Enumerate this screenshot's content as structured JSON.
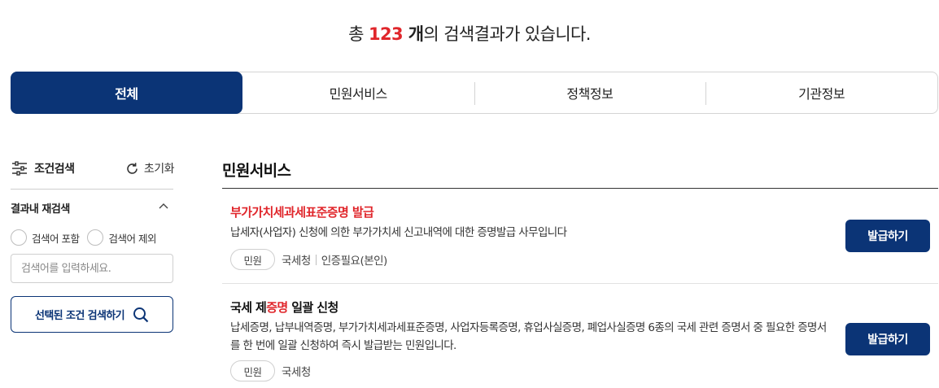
{
  "summary": {
    "prefix": "총 ",
    "count": "123",
    "unit": " 개",
    "suffix": "의 검색결과가 있습니다."
  },
  "tabs": [
    {
      "label": "전체",
      "active": true
    },
    {
      "label": "민원서비스",
      "active": false
    },
    {
      "label": "정책정보",
      "active": false
    },
    {
      "label": "기관정보",
      "active": false
    }
  ],
  "filter": {
    "title": "조건검색",
    "reset_label": "초기화",
    "refine_title": "결과내 재검색",
    "radio_include": "검색어 포함",
    "radio_exclude": "검색어 제외",
    "input_placeholder": "검색어를 입력하세요.",
    "search_button": "선택된 조건 검색하기"
  },
  "section": {
    "title": "민원서비스"
  },
  "results": [
    {
      "title": "부가가치세과세표준증명 발급",
      "description": "납세자(사업자) 신청에 의한 부가가치세 신고내역에 대한 증명발급 사무입니다",
      "badge": "민원",
      "agency": "국세청",
      "auth": "인증필요(본인)",
      "button": "발급하기"
    },
    {
      "title_before": "국세 제",
      "title_highlight": "증명",
      "title_after": " 일괄 신청",
      "description": "납세증명, 납부내역증명, 부가가치세과세표준증명, 사업자등록증명, 휴업사실증명, 폐업사실증명 6종의 국세 관련 증명서 중 필요한 증명서를 한 번에 일괄 신청하여 즉시 발급받는 민원입니다.",
      "badge": "민원",
      "agency": "국세청",
      "button": "발급하기"
    }
  ],
  "colors": {
    "primary": "#0b3476",
    "highlight": "#e0262b"
  },
  "icons": {
    "filter": "sliders-icon",
    "reset": "refresh-icon",
    "collapse": "chevron-up-icon",
    "search": "search-icon"
  }
}
